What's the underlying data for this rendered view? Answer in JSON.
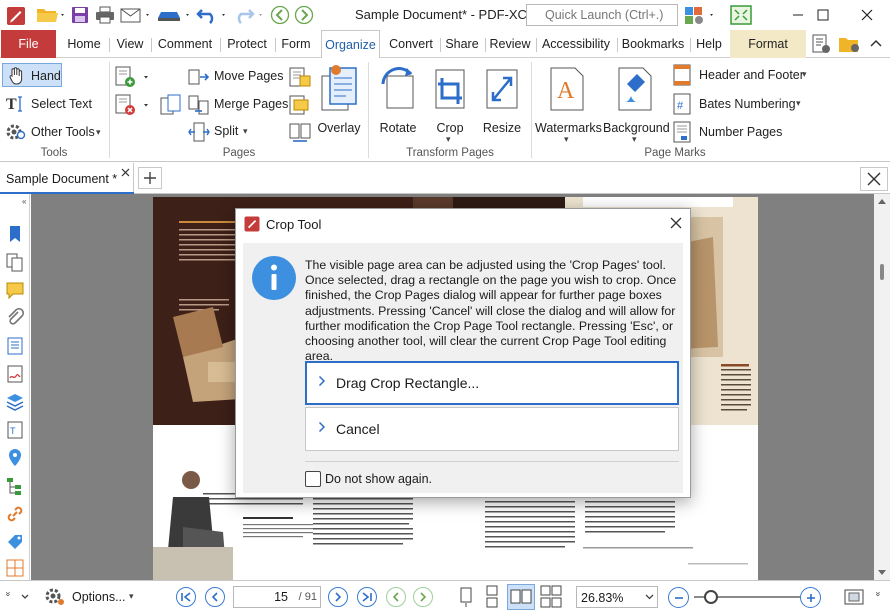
{
  "title_bar": {
    "document_title": "Sample Document* - PDF-XCh...",
    "quick_launch_placeholder": "Quick Launch (Ctrl+.)"
  },
  "menu_tabs": [
    "File",
    "Home",
    "View",
    "Comment",
    "Protect",
    "Form",
    "Organize",
    "Convert",
    "Share",
    "Review",
    "Accessibility",
    "Bookmarks",
    "Help",
    "Format"
  ],
  "active_tab": "Organize",
  "ribbon": {
    "tools": {
      "hand": "Hand",
      "select_text": "Select Text",
      "other_tools": "Other Tools",
      "group": "Tools"
    },
    "pages": {
      "move_pages": "Move Pages",
      "merge_pages": "Merge Pages",
      "split": "Split",
      "overlay": "Overlay",
      "group": "Pages"
    },
    "transform": {
      "rotate": "Rotate",
      "crop": "Crop",
      "resize": "Resize",
      "group": "Transform Pages"
    },
    "marks": {
      "watermarks": "Watermarks",
      "background": "Background",
      "header_footer": "Header and Footer",
      "bates": "Bates Numbering",
      "number_pages": "Number Pages",
      "group": "Page Marks"
    }
  },
  "document_tab": {
    "label": "Sample Document *"
  },
  "dialog": {
    "title": "Crop Tool",
    "message": "The visible page area can be adjusted using the 'Crop Pages' tool. Once selected, drag a rectangle on the page you wish to crop. Once finished, the Crop Pages dialog will appear for further page boxes adjustments. Pressing 'Cancel' will close the dialog and will allow for further modification the Crop Page Tool rectangle. Pressing 'Esc', or choosing another tool, will clear the current Crop Page Tool editing area.",
    "drag_button": "Drag Crop Rectangle...",
    "cancel_button": "Cancel",
    "checkbox_label": "Do not show again.",
    "checkbox_checked": false
  },
  "status_bar": {
    "options": "Options...",
    "current_page": "15",
    "total_pages": "/ 91",
    "zoom": "26.83%"
  },
  "colors": {
    "accent": "#2c6ec9",
    "file_tab": "#c43b3b",
    "format_tab": "#f4e9c6",
    "info_icon": "#3d8fe0"
  }
}
